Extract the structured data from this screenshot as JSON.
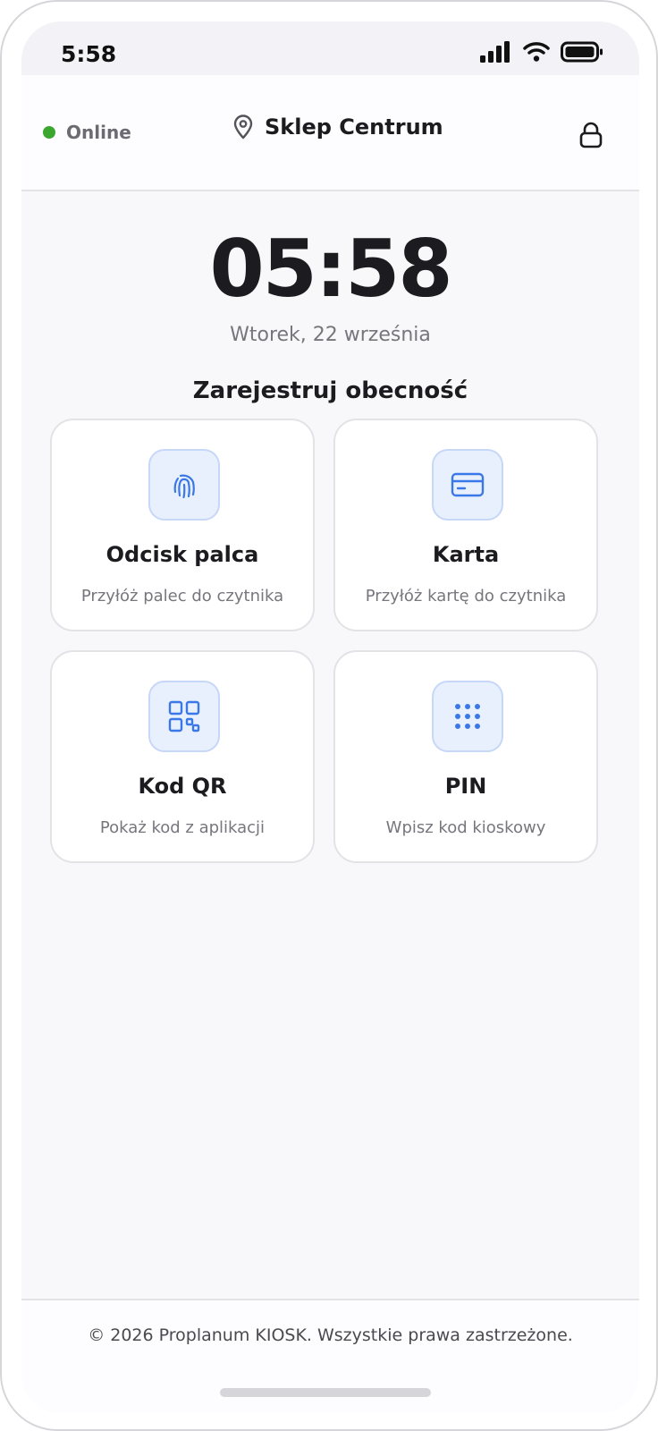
{
  "status_bar": {
    "time": "5:58"
  },
  "header": {
    "status_label": "Online",
    "store_name": "Sklep Centrum"
  },
  "main": {
    "clock": "05:58",
    "date": "Wtorek, 22 września",
    "section_title": "Zarejestruj obecność",
    "methods": [
      {
        "title": "Odcisk palca",
        "description": "Przyłóż palec do czytnika",
        "icon": "fingerprint-icon"
      },
      {
        "title": "Karta",
        "description": "Przyłóż kartę do czytnika",
        "icon": "credit-card-icon"
      },
      {
        "title": "Kod QR",
        "description": "Pokaż kod z aplikacji",
        "icon": "qr-code-icon"
      },
      {
        "title": "PIN",
        "description": "Wpisz kod kioskowy",
        "icon": "keypad-icon"
      }
    ]
  },
  "footer": {
    "text": "© 2026 Proplanum KIOSK. Wszystkie prawa zastrzeżone."
  },
  "colors": {
    "accent": "#3b78e7",
    "online": "#3ba72e",
    "icon_bg": "#e9f0fd"
  }
}
